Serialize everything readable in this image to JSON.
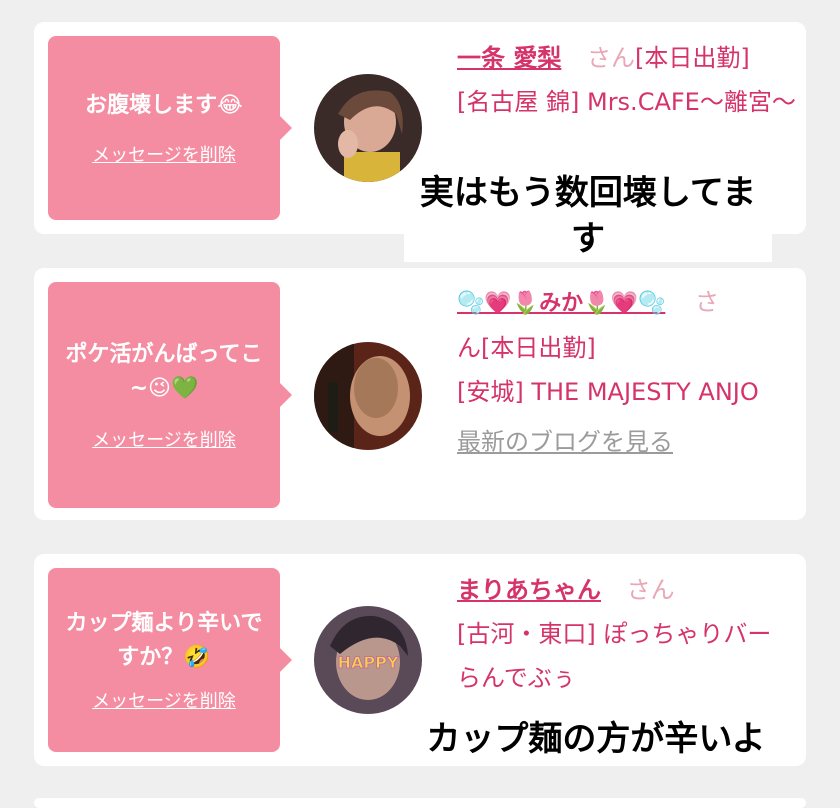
{
  "entries": [
    {
      "message": "お腹壊します😂",
      "delete_label": "メッセージを削除",
      "name": "一条 愛梨",
      "san": "さん",
      "status": "[本日出勤]",
      "location": "[名古屋 錦] Mrs.CAFE〜離宮〜",
      "blog_label": ""
    },
    {
      "message": "ポケ活がんばってこ~😉💚",
      "delete_label": "メッセージを削除",
      "name": "🫧💗🌷みか🌷💗🫧",
      "san": "さ",
      "status": "ん[本日出勤]",
      "location": "[安城] THE MAJESTY ANJO",
      "blog_label": "最新のブログを見る"
    },
    {
      "message": "カップ麺より辛いですか？🤣",
      "delete_label": "メッセージを削除",
      "name": "まりあちゃん",
      "san": "さん",
      "status": "",
      "location": "[古河・東口] ぽっちゃりバー らんでぶぅ",
      "blog_label": ""
    }
  ],
  "captions": {
    "first": "実はもう数回壊してます",
    "second": "カップ麺の方が辛いよ"
  },
  "colors": {
    "bubble": "#f58da2",
    "name": "#d5336a",
    "san": "#e8a8b8",
    "blog": "#9b9b9b"
  }
}
